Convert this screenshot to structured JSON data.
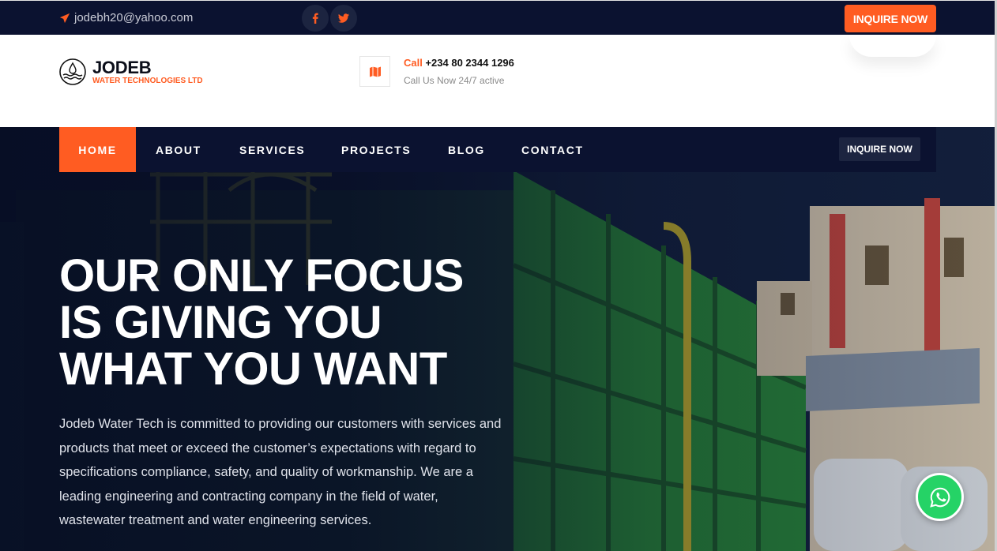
{
  "topbar": {
    "email": "jodebh20@yahoo.com",
    "inquire_label": "INQUIRE NOW"
  },
  "header": {
    "logo_name": "JODEB",
    "logo_sub": "WATER TECHNOLOGIES LTD",
    "call_label": "Call",
    "phone": "+234 80 2344 1296",
    "call_sub": "Call Us Now 24/7 active"
  },
  "nav": {
    "items": [
      "HOME",
      "ABOUT",
      "SERVICES",
      "PROJECTS",
      "BLOG",
      "CONTACT"
    ],
    "active": "HOME",
    "inquire_label": "INQUIRE NOW"
  },
  "hero": {
    "headline": [
      "OUR ONLY FOCUS",
      "IS GIVING YOU",
      "WHAT YOU WANT"
    ],
    "lead": "Jodeb Water Tech is committed to providing our customers with services and products that meet or exceed the customer’s expectations with regard to specifications compliance, safety, and quality of workmanship. We are a leading engineering and contracting company in the field of water, wastewater treatment and water engineering services."
  },
  "colors": {
    "accent": "#ff5c22",
    "navy": "#0b1230",
    "whatsapp": "#25d366"
  },
  "icons": [
    "paper-plane-icon",
    "facebook-icon",
    "twitter-icon",
    "water-drop-logo-icon",
    "map-icon",
    "whatsapp-icon"
  ]
}
